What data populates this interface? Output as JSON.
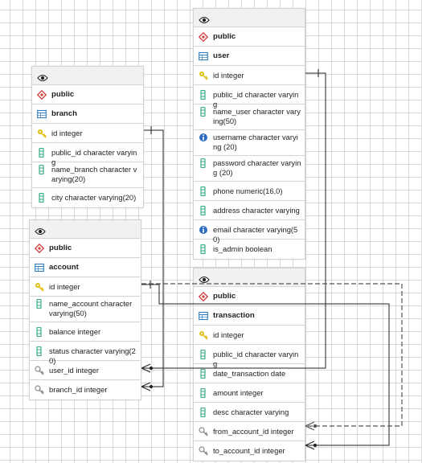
{
  "colors": {
    "key": "#e1c016",
    "column": "#3aae86",
    "schema": "#d23e3e",
    "table": "#2f7dbf",
    "info": "#2f6cbf",
    "line": "#222222"
  },
  "tables": {
    "user": {
      "schema": "public",
      "name": "user",
      "columns": [
        {
          "text": "id integer",
          "icon": "key-icon"
        },
        {
          "text": "public_id character varying",
          "icon": "column-icon"
        },
        {
          "text": "name_user character varying(50)",
          "icon": "column-icon"
        },
        {
          "text": "username character varying (20)",
          "icon": "unique-icon"
        },
        {
          "text": "password character varying (20)",
          "icon": "column-icon"
        },
        {
          "text": "phone numeric(16,0)",
          "icon": "column-icon"
        },
        {
          "text": "address character varying",
          "icon": "column-icon"
        },
        {
          "text": "email character varying(50)",
          "icon": "unique-icon"
        },
        {
          "text": "is_admin boolean",
          "icon": "column-icon"
        }
      ]
    },
    "branch": {
      "schema": "public",
      "name": "branch",
      "columns": [
        {
          "text": "id integer",
          "icon": "key-icon"
        },
        {
          "text": "public_id character varying",
          "icon": "column-icon"
        },
        {
          "text": "name_branch character varying(20)",
          "icon": "column-icon"
        },
        {
          "text": "city character varying(20)",
          "icon": "column-icon"
        }
      ]
    },
    "account": {
      "schema": "public",
      "name": "account",
      "columns": [
        {
          "text": "id integer",
          "icon": "key-icon"
        },
        {
          "text": "name_account character varying(50)",
          "icon": "column-icon"
        },
        {
          "text": "balance integer",
          "icon": "column-icon"
        },
        {
          "text": "status character varying(20)",
          "icon": "column-icon"
        },
        {
          "text": "user_id integer",
          "icon": "fk-icon"
        },
        {
          "text": "branch_id integer",
          "icon": "fk-icon"
        }
      ]
    },
    "transaction": {
      "schema": "public",
      "name": "transaction",
      "columns": [
        {
          "text": "id integer",
          "icon": "key-icon"
        },
        {
          "text": "public_id character varying",
          "icon": "column-icon"
        },
        {
          "text": "date_transaction date",
          "icon": "column-icon"
        },
        {
          "text": "amount integer",
          "icon": "column-icon"
        },
        {
          "text": "desc character varying",
          "icon": "column-icon"
        },
        {
          "text": "from_account_id integer",
          "icon": "fk-icon"
        },
        {
          "text": "to_account_id integer",
          "icon": "fk-icon"
        }
      ]
    }
  }
}
